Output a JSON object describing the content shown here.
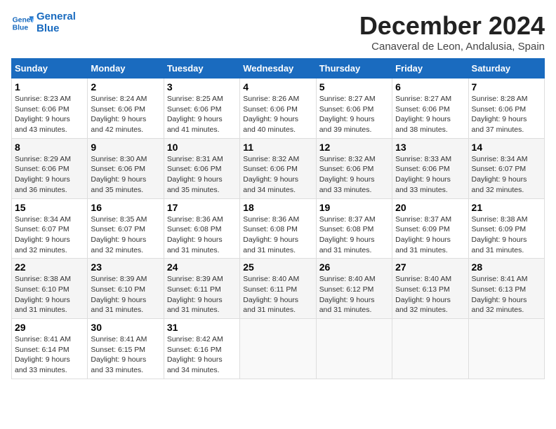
{
  "logo": {
    "line1": "General",
    "line2": "Blue"
  },
  "title": "December 2024",
  "subtitle": "Canaveral de Leon, Andalusia, Spain",
  "days_header": [
    "Sunday",
    "Monday",
    "Tuesday",
    "Wednesday",
    "Thursday",
    "Friday",
    "Saturday"
  ],
  "weeks": [
    [
      {
        "day": "1",
        "info": "Sunrise: 8:23 AM\nSunset: 6:06 PM\nDaylight: 9 hours\nand 43 minutes."
      },
      {
        "day": "2",
        "info": "Sunrise: 8:24 AM\nSunset: 6:06 PM\nDaylight: 9 hours\nand 42 minutes."
      },
      {
        "day": "3",
        "info": "Sunrise: 8:25 AM\nSunset: 6:06 PM\nDaylight: 9 hours\nand 41 minutes."
      },
      {
        "day": "4",
        "info": "Sunrise: 8:26 AM\nSunset: 6:06 PM\nDaylight: 9 hours\nand 40 minutes."
      },
      {
        "day": "5",
        "info": "Sunrise: 8:27 AM\nSunset: 6:06 PM\nDaylight: 9 hours\nand 39 minutes."
      },
      {
        "day": "6",
        "info": "Sunrise: 8:27 AM\nSunset: 6:06 PM\nDaylight: 9 hours\nand 38 minutes."
      },
      {
        "day": "7",
        "info": "Sunrise: 8:28 AM\nSunset: 6:06 PM\nDaylight: 9 hours\nand 37 minutes."
      }
    ],
    [
      {
        "day": "8",
        "info": "Sunrise: 8:29 AM\nSunset: 6:06 PM\nDaylight: 9 hours\nand 36 minutes."
      },
      {
        "day": "9",
        "info": "Sunrise: 8:30 AM\nSunset: 6:06 PM\nDaylight: 9 hours\nand 35 minutes."
      },
      {
        "day": "10",
        "info": "Sunrise: 8:31 AM\nSunset: 6:06 PM\nDaylight: 9 hours\nand 35 minutes."
      },
      {
        "day": "11",
        "info": "Sunrise: 8:32 AM\nSunset: 6:06 PM\nDaylight: 9 hours\nand 34 minutes."
      },
      {
        "day": "12",
        "info": "Sunrise: 8:32 AM\nSunset: 6:06 PM\nDaylight: 9 hours\nand 33 minutes."
      },
      {
        "day": "13",
        "info": "Sunrise: 8:33 AM\nSunset: 6:06 PM\nDaylight: 9 hours\nand 33 minutes."
      },
      {
        "day": "14",
        "info": "Sunrise: 8:34 AM\nSunset: 6:07 PM\nDaylight: 9 hours\nand 32 minutes."
      }
    ],
    [
      {
        "day": "15",
        "info": "Sunrise: 8:34 AM\nSunset: 6:07 PM\nDaylight: 9 hours\nand 32 minutes."
      },
      {
        "day": "16",
        "info": "Sunrise: 8:35 AM\nSunset: 6:07 PM\nDaylight: 9 hours\nand 32 minutes."
      },
      {
        "day": "17",
        "info": "Sunrise: 8:36 AM\nSunset: 6:08 PM\nDaylight: 9 hours\nand 31 minutes."
      },
      {
        "day": "18",
        "info": "Sunrise: 8:36 AM\nSunset: 6:08 PM\nDaylight: 9 hours\nand 31 minutes."
      },
      {
        "day": "19",
        "info": "Sunrise: 8:37 AM\nSunset: 6:08 PM\nDaylight: 9 hours\nand 31 minutes."
      },
      {
        "day": "20",
        "info": "Sunrise: 8:37 AM\nSunset: 6:09 PM\nDaylight: 9 hours\nand 31 minutes."
      },
      {
        "day": "21",
        "info": "Sunrise: 8:38 AM\nSunset: 6:09 PM\nDaylight: 9 hours\nand 31 minutes."
      }
    ],
    [
      {
        "day": "22",
        "info": "Sunrise: 8:38 AM\nSunset: 6:10 PM\nDaylight: 9 hours\nand 31 minutes."
      },
      {
        "day": "23",
        "info": "Sunrise: 8:39 AM\nSunset: 6:10 PM\nDaylight: 9 hours\nand 31 minutes."
      },
      {
        "day": "24",
        "info": "Sunrise: 8:39 AM\nSunset: 6:11 PM\nDaylight: 9 hours\nand 31 minutes."
      },
      {
        "day": "25",
        "info": "Sunrise: 8:40 AM\nSunset: 6:11 PM\nDaylight: 9 hours\nand 31 minutes."
      },
      {
        "day": "26",
        "info": "Sunrise: 8:40 AM\nSunset: 6:12 PM\nDaylight: 9 hours\nand 31 minutes."
      },
      {
        "day": "27",
        "info": "Sunrise: 8:40 AM\nSunset: 6:13 PM\nDaylight: 9 hours\nand 32 minutes."
      },
      {
        "day": "28",
        "info": "Sunrise: 8:41 AM\nSunset: 6:13 PM\nDaylight: 9 hours\nand 32 minutes."
      }
    ],
    [
      {
        "day": "29",
        "info": "Sunrise: 8:41 AM\nSunset: 6:14 PM\nDaylight: 9 hours\nand 33 minutes."
      },
      {
        "day": "30",
        "info": "Sunrise: 8:41 AM\nSunset: 6:15 PM\nDaylight: 9 hours\nand 33 minutes."
      },
      {
        "day": "31",
        "info": "Sunrise: 8:42 AM\nSunset: 6:16 PM\nDaylight: 9 hours\nand 34 minutes."
      },
      {
        "day": "",
        "info": ""
      },
      {
        "day": "",
        "info": ""
      },
      {
        "day": "",
        "info": ""
      },
      {
        "day": "",
        "info": ""
      }
    ]
  ]
}
